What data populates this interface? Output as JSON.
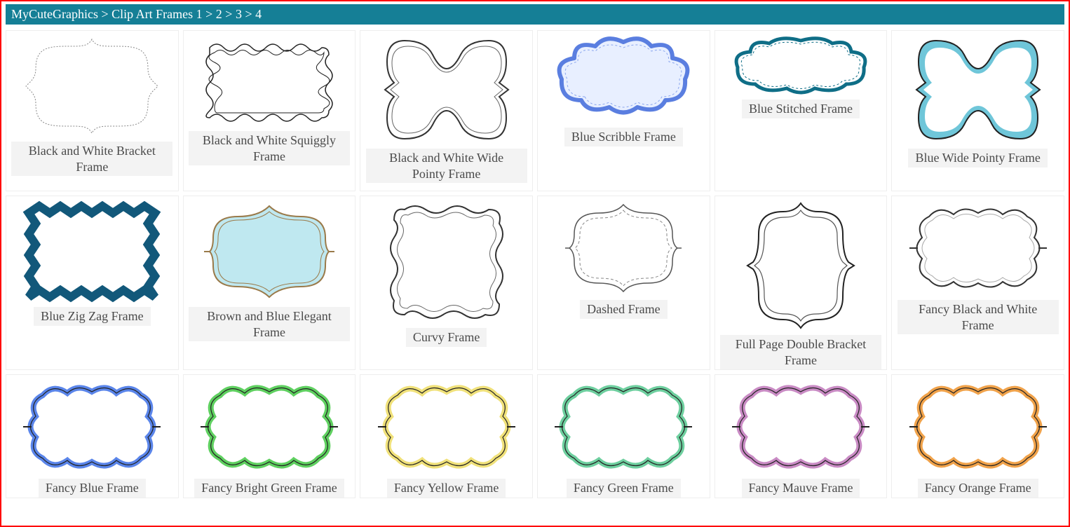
{
  "breadcrumb": {
    "site": "MyCuteGraphics",
    "sep": ">",
    "category": "Clip Art Frames",
    "pages": [
      "1",
      "2",
      "3",
      "4"
    ]
  },
  "items": [
    {
      "label": "Black and White Bracket Frame"
    },
    {
      "label": "Black and White Squiggly Frame"
    },
    {
      "label": "Black and White Wide Pointy Frame"
    },
    {
      "label": "Blue Scribble Frame"
    },
    {
      "label": "Blue Stitched Frame"
    },
    {
      "label": "Blue Wide Pointy Frame"
    },
    {
      "label": "Blue Zig Zag Frame"
    },
    {
      "label": "Brown and Blue Elegant Frame"
    },
    {
      "label": "Curvy Frame"
    },
    {
      "label": "Dashed Frame"
    },
    {
      "label": "Full Page Double Bracket Frame"
    },
    {
      "label": "Fancy Black and White Frame"
    },
    {
      "label": "Fancy Blue Frame"
    },
    {
      "label": "Fancy Bright Green Frame"
    },
    {
      "label": "Fancy Yellow Frame"
    },
    {
      "label": "Fancy Green Frame"
    },
    {
      "label": "Fancy Mauve Frame"
    },
    {
      "label": "Fancy Orange Frame"
    }
  ]
}
